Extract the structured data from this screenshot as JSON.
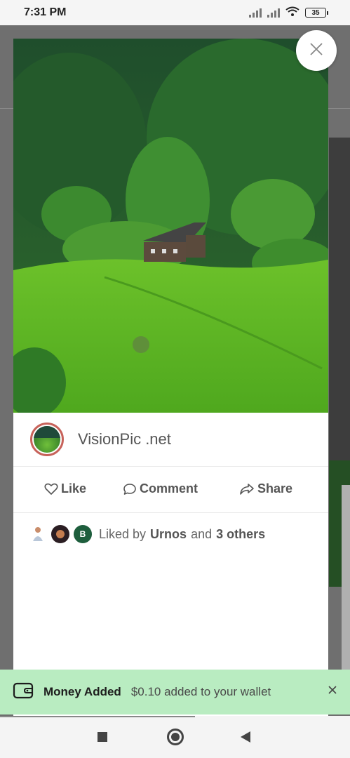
{
  "status_bar": {
    "time": "7:31 PM",
    "battery": "35",
    "icons": [
      "signal-icon",
      "signal-icon",
      "wifi-icon",
      "battery-icon"
    ]
  },
  "post": {
    "author": "VisionPic .net",
    "image_icon": "landscape-photo-forest-house",
    "actions": {
      "like": "Like",
      "comment": "Comment",
      "share": "Share"
    },
    "likes": {
      "prefix": "Liked by",
      "user": "Urnos",
      "connector": "and",
      "others": "3 others",
      "avatar_initial": "B"
    }
  },
  "close_icon": "close-icon",
  "toast": {
    "title": "Money Added",
    "message": "$0.10 added to your wallet",
    "icon": "wallet-icon",
    "close_icon": "close-icon",
    "background": "#b9ecc1"
  },
  "nav": {
    "icons": [
      "recents-square-icon",
      "home-circle-icon",
      "back-triangle-icon"
    ]
  }
}
